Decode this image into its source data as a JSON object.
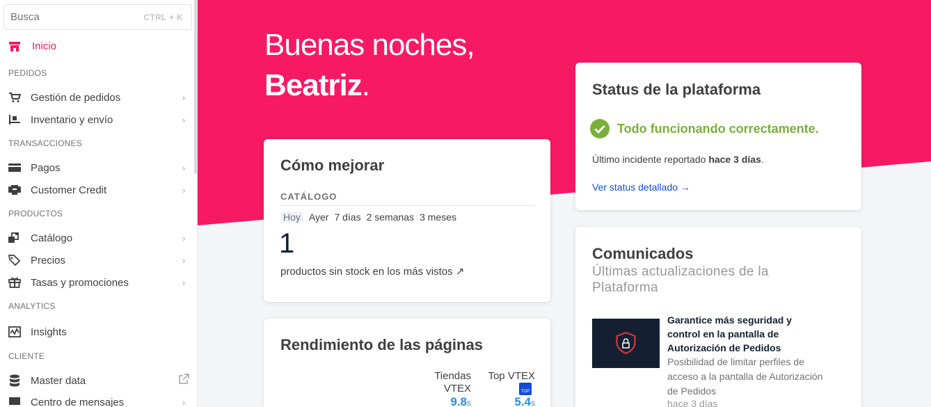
{
  "sidebar": {
    "search": {
      "placeholder": "Busca",
      "shortcut": "CTRL + K"
    },
    "home": {
      "label": "Inicio"
    },
    "sections": {
      "pedidos": "PEDIDOS",
      "transacciones": "TRANSACCIONES",
      "productos": "PRODUCTOS",
      "analytics": "ANALYTICS",
      "cliente": "CLIENTE"
    },
    "items": {
      "gestion": "Gestión de pedidos",
      "inventario": "Inventario y envío",
      "pagos": "Pagos",
      "credit": "Customer Credit",
      "catalogo": "Catálogo",
      "precios": "Precios",
      "tasas": "Tasas y promociones",
      "insights": "Insights",
      "master": "Master data",
      "mensajes": "Centro de mensajes"
    }
  },
  "greeting": {
    "line1": "Buenas noches,",
    "name": "Beatriz",
    "punct": "."
  },
  "improve": {
    "title": "Cómo mejorar",
    "section": "CATÁLOGO",
    "tabs": [
      "Hoy",
      "Ayer",
      "7 días",
      "2 semanas",
      "3 meses"
    ],
    "value": "1",
    "caption": "productos sin stock en los más vistos ↗"
  },
  "performance": {
    "title": "Rendimiento de las páginas",
    "col1_label_1": "Tiendas",
    "col1_label_2": "VTEX",
    "col2_label": "Top VTEX",
    "col1_value": "9.8",
    "col2_value": "5.4",
    "unit": "s",
    "badge": "TOP"
  },
  "status": {
    "title": "Status de la plataforma",
    "ok": "Todo funcionando correctamente.",
    "last_prefix": "Último incidente reportado ",
    "last_bold": "hace 3 días",
    "last_suffix": ".",
    "link": "Ver status detallado →"
  },
  "news": {
    "title": "Comunicados",
    "subtitle": "Últimas actualizaciones de la Plataforma",
    "item_title": "Garantice más seguridad y control en la pantalla de Autorización de Pedidos",
    "item_body": "Posibilidad de limitar perfiles de acceso a la pantalla de Autorización de Pedidos",
    "item_time": "hace 3 días"
  },
  "colors": {
    "brand": "#f71963",
    "success": "#79b03a",
    "link": "#134cd8"
  }
}
